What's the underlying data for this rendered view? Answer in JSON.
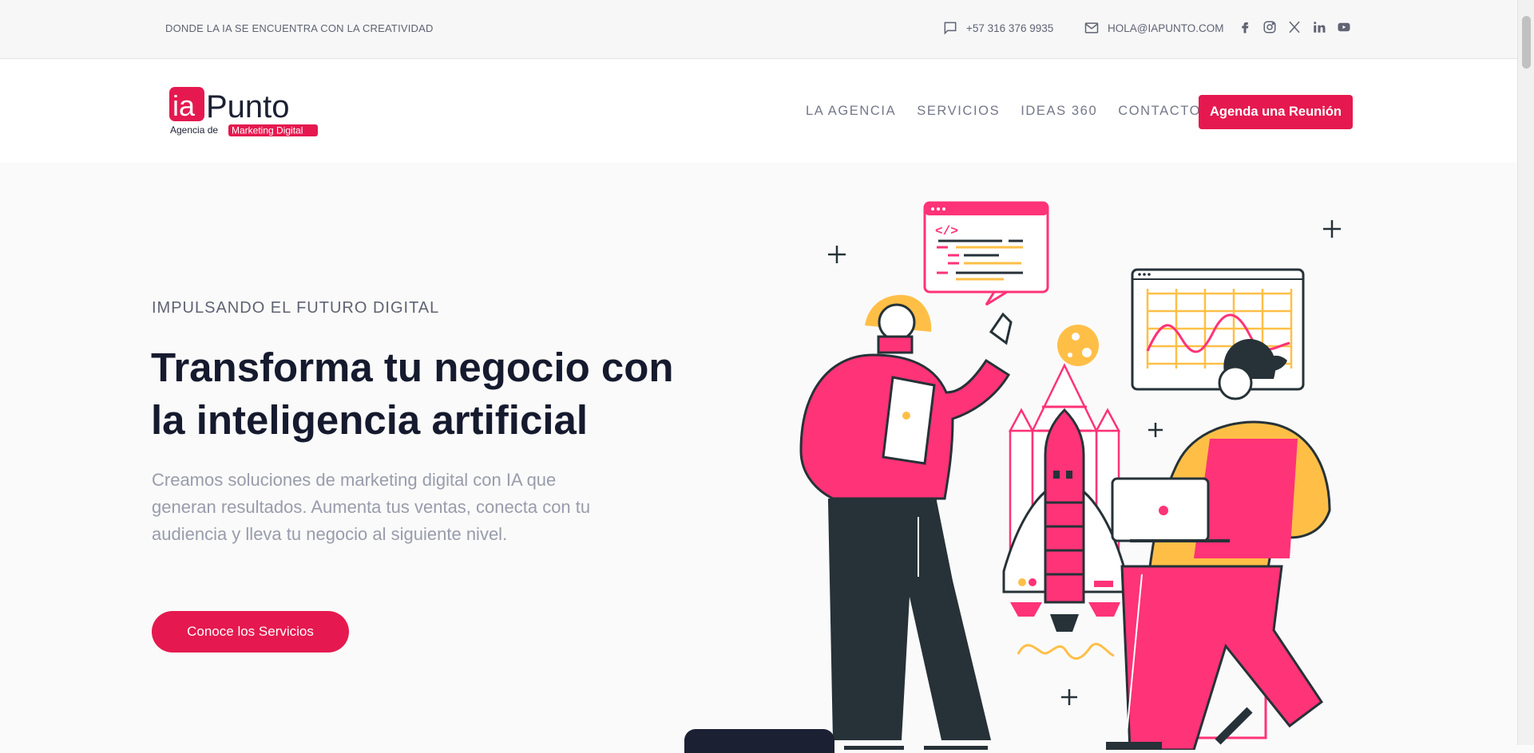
{
  "topbar": {
    "tagline": "DONDE LA IA SE ENCUENTRA CON LA CREATIVIDAD",
    "phone": "+57 316 376 9935",
    "email": "HOLA@IAPUNTO.COM",
    "socials": [
      "facebook-icon",
      "instagram-icon",
      "x-icon",
      "linkedin-icon",
      "youtube-icon"
    ]
  },
  "logo": {
    "mark": "ia",
    "name": "Punto",
    "line1": "Agencia de",
    "line2": "Marketing Digital"
  },
  "nav": {
    "items": [
      "LA AGENCIA",
      "SERVICIOS",
      "IDEAS 360",
      "CONTACTO"
    ],
    "cta": "Agenda una Reunión"
  },
  "hero": {
    "eyebrow": "IMPULSANDO EL FUTURO DIGITAL",
    "title": "Transforma tu negocio con la inteligencia artificial",
    "lead": "Creamos soluciones de marketing digital con IA que generan resultados. Aumenta tus ventas, conecta con tu audiencia y lleva tu negocio al siguiente nivel.",
    "cta": "Conoce los Servicios"
  },
  "colors": {
    "accent": "#e5194f",
    "pink": "#ff3377",
    "yellow": "#ffbf47",
    "dark": "#263238"
  }
}
